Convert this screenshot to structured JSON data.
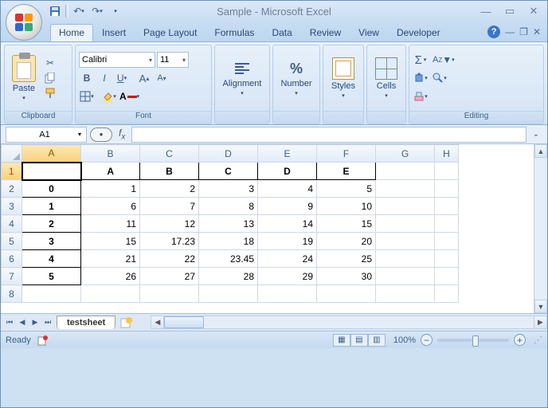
{
  "title": "Sample - Microsoft Excel",
  "qat": {
    "save": "💾",
    "undo": "↶",
    "redo": "↷"
  },
  "tabs": [
    "Home",
    "Insert",
    "Page Layout",
    "Formulas",
    "Data",
    "Review",
    "View",
    "Developer"
  ],
  "active_tab": 0,
  "ribbon": {
    "clipboard": {
      "label": "Clipboard",
      "paste": "Paste"
    },
    "font": {
      "label": "Font",
      "name": "Calibri",
      "size": "11"
    },
    "alignment": {
      "label": "Alignment"
    },
    "number": {
      "label": "Number"
    },
    "styles": {
      "label": "Styles"
    },
    "cells": {
      "label": "Cells"
    },
    "editing": {
      "label": "Editing"
    }
  },
  "namebox": "A1",
  "formula": "",
  "columns": [
    "A",
    "B",
    "C",
    "D",
    "E",
    "F",
    "G",
    "H"
  ],
  "rows": [
    "1",
    "2",
    "3",
    "4",
    "5",
    "6",
    "7",
    "8"
  ],
  "chart_data": {
    "type": "table",
    "headers": [
      "",
      "A",
      "B",
      "C",
      "D",
      "E"
    ],
    "rows": [
      [
        "0",
        1,
        2,
        3,
        4,
        5
      ],
      [
        "1",
        6,
        7,
        8,
        9,
        10
      ],
      [
        "2",
        11,
        12,
        13,
        14,
        15
      ],
      [
        "3",
        15,
        17.23,
        18,
        19,
        20
      ],
      [
        "4",
        21,
        22,
        23.45,
        24,
        25
      ],
      [
        "5",
        26,
        27,
        28,
        29,
        30
      ]
    ]
  },
  "sheet": "testsheet",
  "status": {
    "ready": "Ready",
    "zoom": "100%"
  }
}
